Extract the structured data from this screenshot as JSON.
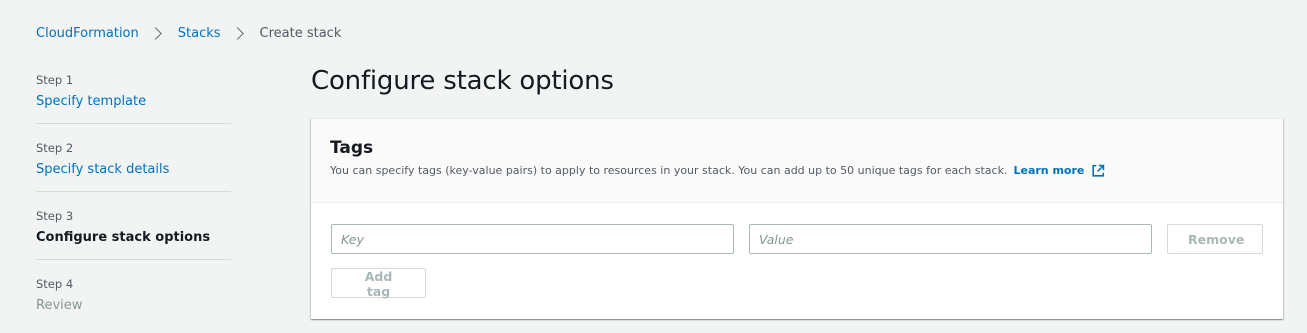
{
  "breadcrumb": {
    "items": [
      "CloudFormation",
      "Stacks"
    ],
    "current": "Create stack"
  },
  "steps": [
    {
      "number": "Step 1",
      "title": "Specify template",
      "state": "link"
    },
    {
      "number": "Step 2",
      "title": "Specify stack details",
      "state": "link"
    },
    {
      "number": "Step 3",
      "title": "Configure stack options",
      "state": "active"
    },
    {
      "number": "Step 4",
      "title": "Review",
      "state": "disabled"
    }
  ],
  "page": {
    "title": "Configure stack options"
  },
  "tags_panel": {
    "title": "Tags",
    "description": "You can specify tags (key-value pairs) to apply to resources in your stack. You can add up to 50 unique tags for each stack.",
    "learn_more": "Learn more",
    "key_placeholder": "Key",
    "value_placeholder": "Value",
    "key_value": "",
    "value_value": "",
    "remove_label": "Remove",
    "add_tag_label": "Add tag"
  },
  "icons": {
    "breadcrumb_separator": "chevron-right-icon",
    "learn_more": "external-link-icon"
  },
  "colors": {
    "link": "#0073bb",
    "text": "#16191f",
    "muted": "#545b64",
    "disabled": "#879596",
    "background": "#f2f3f3"
  }
}
